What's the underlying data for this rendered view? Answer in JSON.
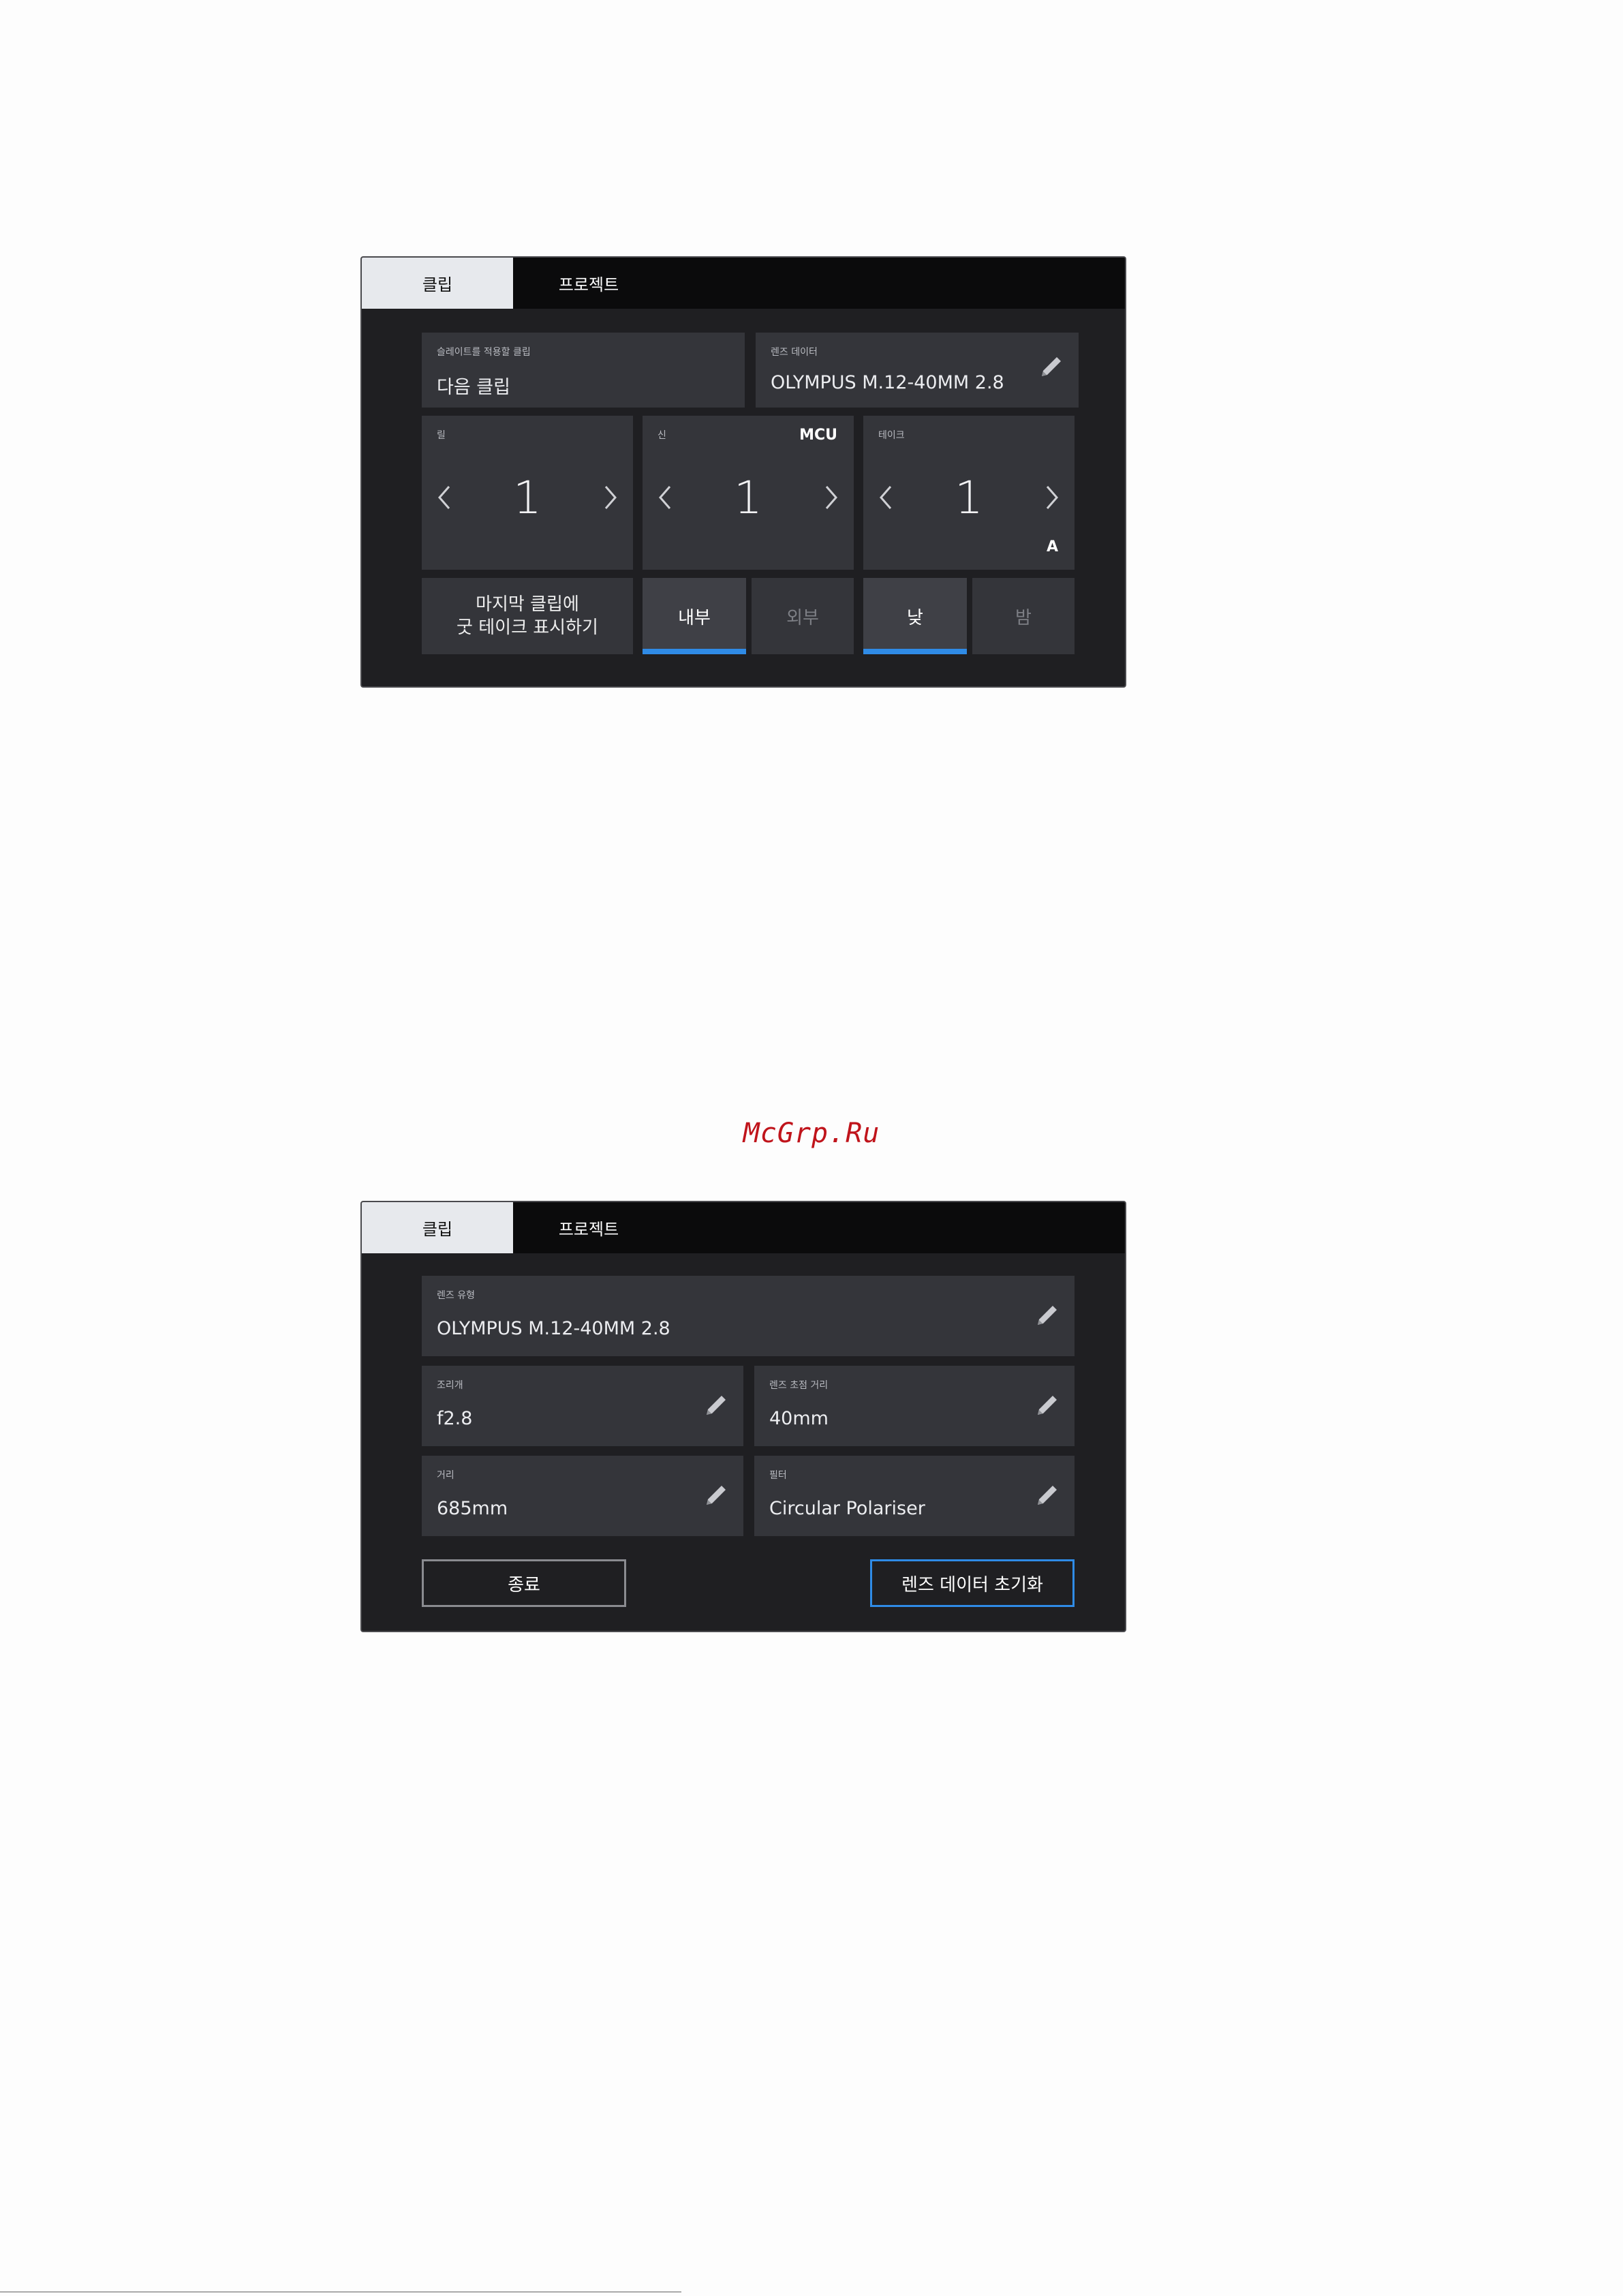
{
  "screen1": {
    "tabs": [
      {
        "label": "클립"
      },
      {
        "label": "프로젝트"
      }
    ],
    "slate_target": {
      "label": "슬레이트를 적용할 클립",
      "value": "다음 클립"
    },
    "lens_data": {
      "label": "렌즈 데이터",
      "value": "OLYMPUS M.12-40MM 2.8"
    },
    "reel": {
      "label": "릴",
      "value": "1"
    },
    "scene": {
      "label": "신",
      "value": "1",
      "badge": "MCU"
    },
    "take": {
      "label": "테이크",
      "value": "1",
      "badge": "A"
    },
    "good_take": {
      "line1": "마지막 클립에",
      "line2": "굿 테이크 표시하기"
    },
    "toggles": {
      "interior": {
        "label": "내부",
        "selected": true
      },
      "exterior": {
        "label": "외부",
        "selected": false
      },
      "day": {
        "label": "낮",
        "selected": true
      },
      "night": {
        "label": "밤",
        "selected": false
      }
    }
  },
  "watermark": "McGrp.Ru",
  "screen2": {
    "tabs": [
      {
        "label": "클립"
      },
      {
        "label": "프로젝트"
      }
    ],
    "lens_type": {
      "label": "렌즈 유형",
      "value": "OLYMPUS M.12-40MM 2.8"
    },
    "iris": {
      "label": "조리개",
      "value": "f2.8"
    },
    "focal_length": {
      "label": "렌즈 초점 거리",
      "value": "40mm"
    },
    "distance": {
      "label": "거리",
      "value": "685mm"
    },
    "filter": {
      "label": "필터",
      "value": "Circular Polariser"
    },
    "done_label": "종료",
    "reset_label": "렌즈 데이터 초기화"
  },
  "colors": {
    "accent": "#2f8be6",
    "panel": "#34353a",
    "background": "#1f1f22",
    "watermark": "#c0141b"
  }
}
